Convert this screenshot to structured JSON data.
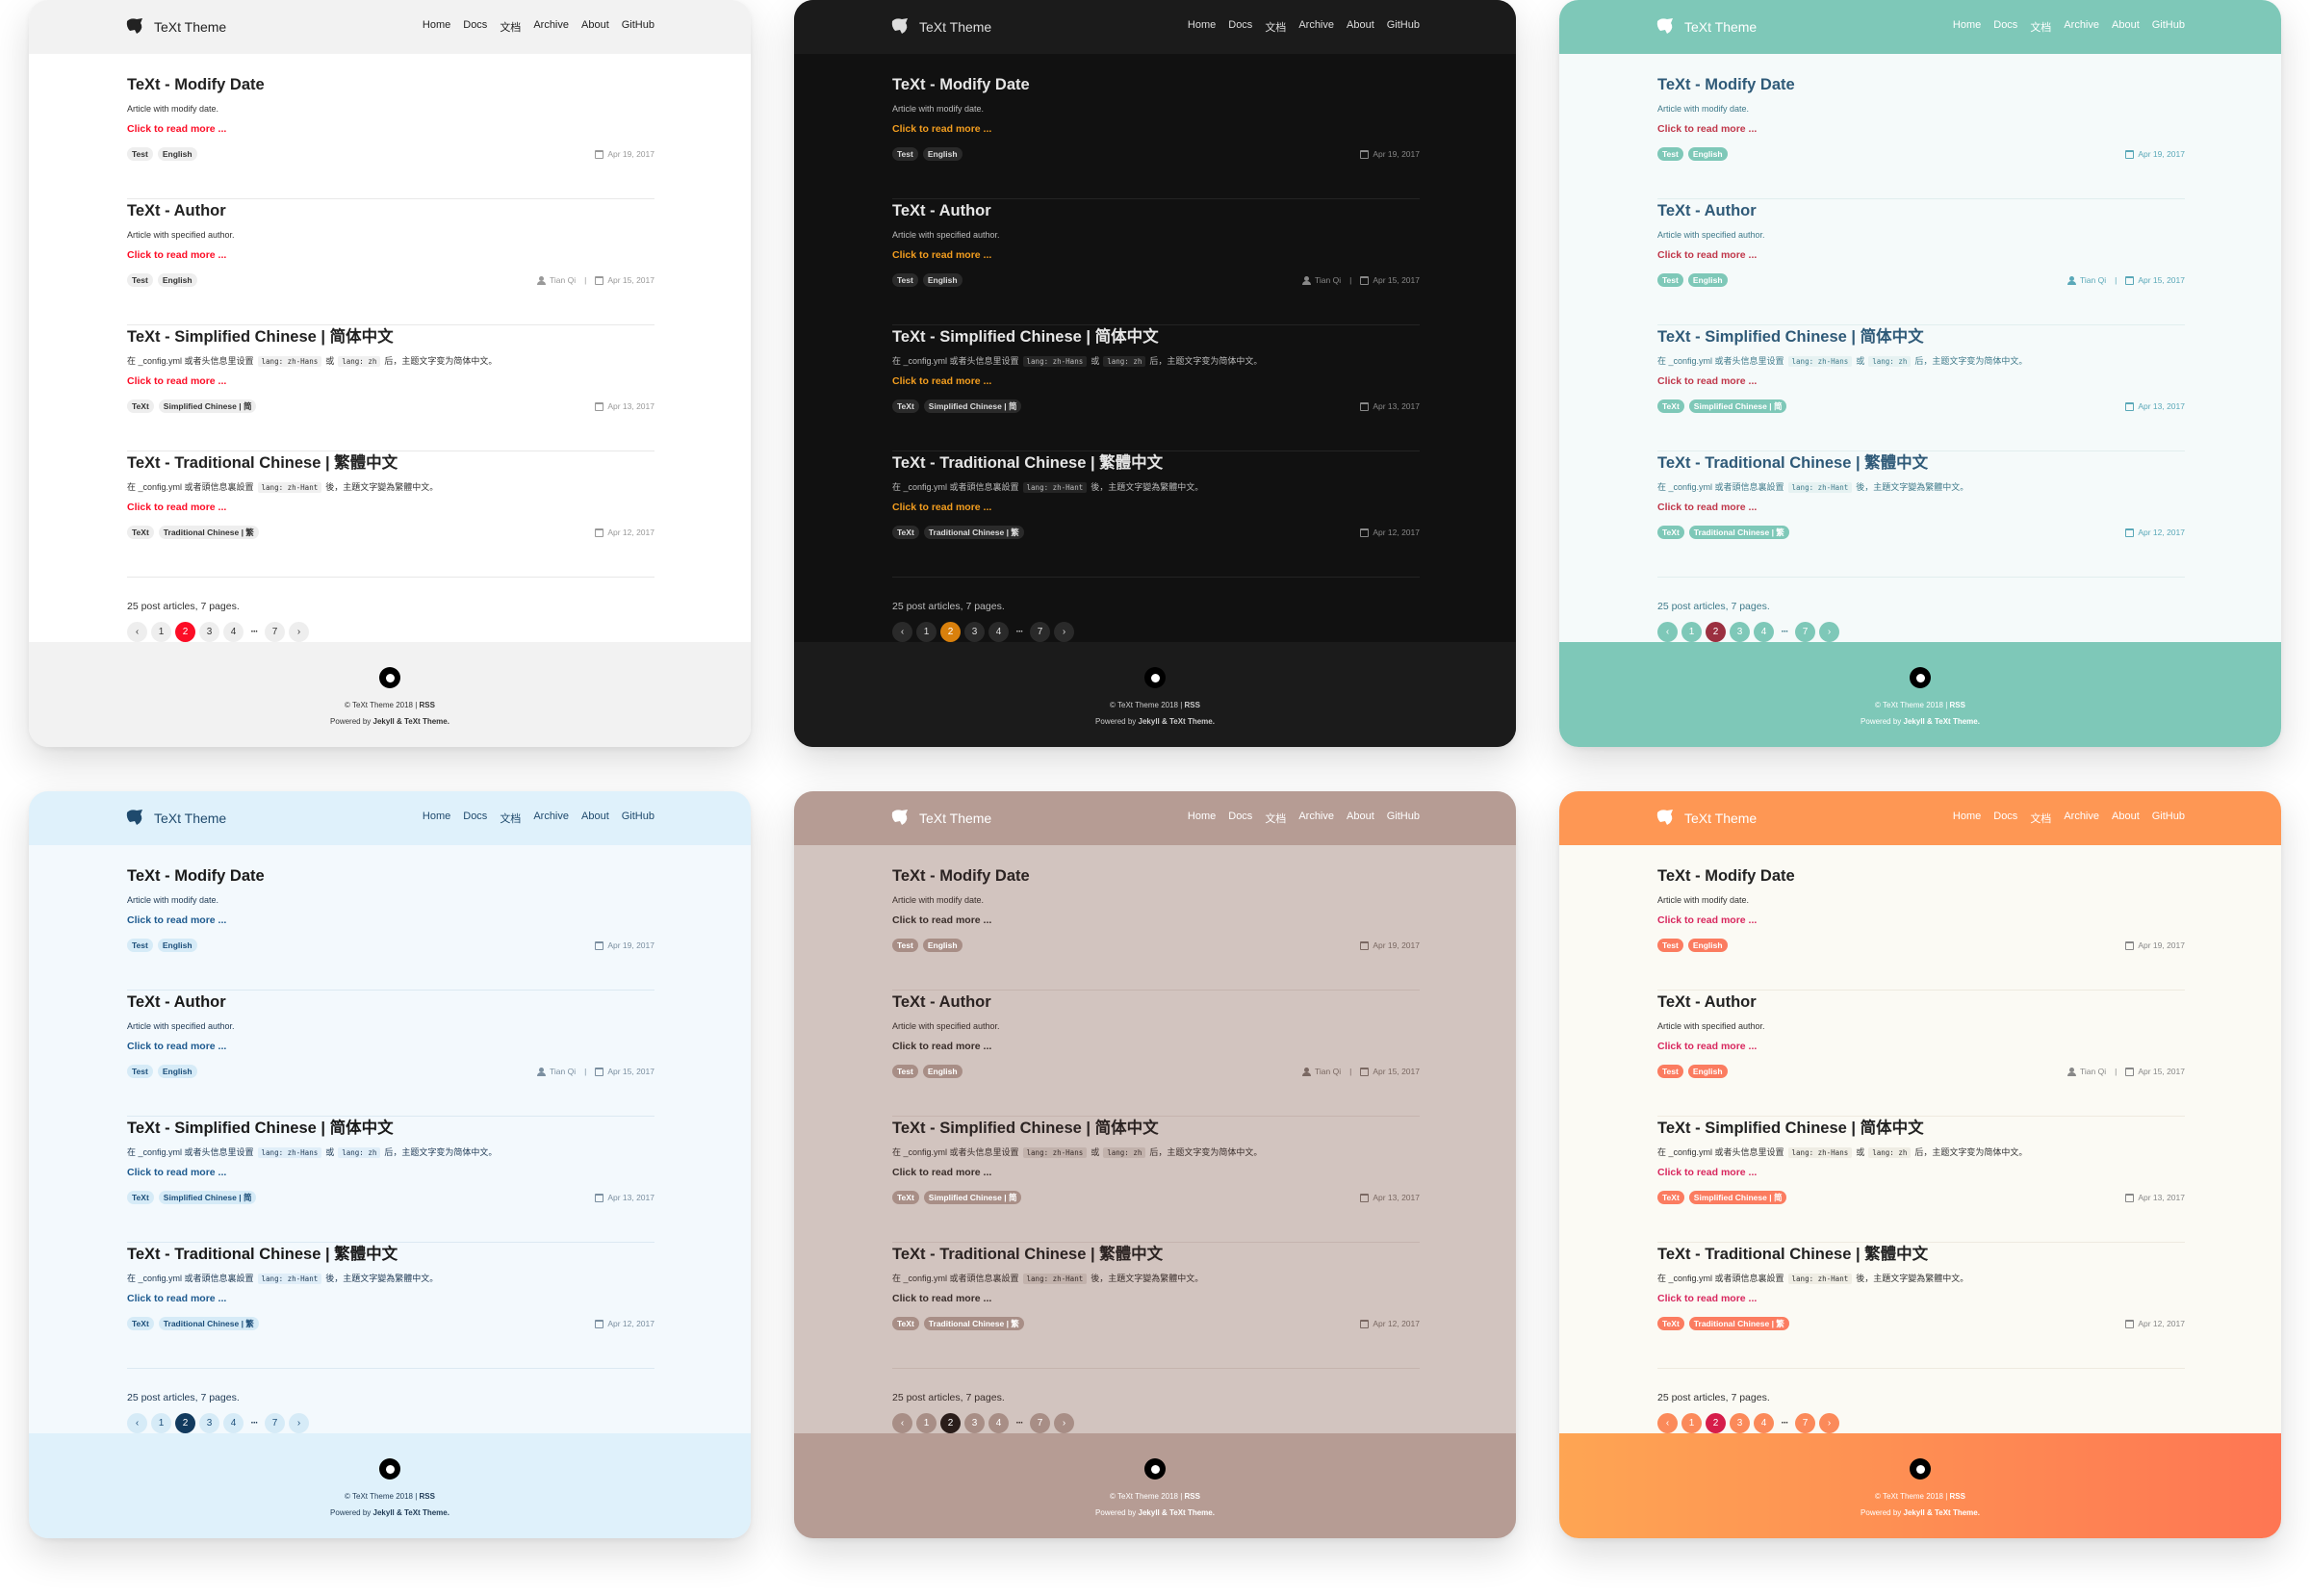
{
  "site": {
    "brand": "TeXt Theme",
    "nav": [
      "Home",
      "Docs",
      "文档",
      "Archive",
      "About",
      "GitHub"
    ],
    "read_more": "Click to read more ...",
    "summary": "25 post articles, 7 pages.",
    "pager": [
      "‹",
      "1",
      "2",
      "3",
      "4",
      "···",
      "7",
      "›"
    ],
    "footer_copy": "© TeXt Theme 2018 | ",
    "footer_rss": "RSS",
    "footer_powered_prefix": "Powered by ",
    "footer_powered_strong": "Jekyll & TeXt Theme.",
    "articles": [
      {
        "title": "TeXt - Modify Date",
        "excerpt_before": "Article with modify date.",
        "code1": "",
        "mid": "",
        "code2": "",
        "after": "",
        "tags": [
          "Test",
          "English"
        ],
        "author": "",
        "date": "Apr 19, 2017"
      },
      {
        "title": "TeXt - Author",
        "excerpt_before": "Article with specified author.",
        "code1": "",
        "mid": "",
        "code2": "",
        "after": "",
        "tags": [
          "Test",
          "English"
        ],
        "author": "Tian Qi",
        "date": "Apr 15, 2017"
      },
      {
        "title": "TeXt - Simplified Chinese | 简体中文",
        "excerpt_before": "在 _config.yml 或者头信息里设置",
        "code1": "lang: zh-Hans",
        "mid": "或",
        "code2": "lang: zh",
        "after": "后，主题文字变为简体中文。",
        "tags": [
          "TeXt",
          "Simplified Chinese | 简"
        ],
        "author": "",
        "date": "Apr 13, 2017"
      },
      {
        "title": "TeXt - Traditional Chinese | 繁體中文",
        "excerpt_before": "在 _config.yml 或者頭信息裏設置",
        "code1": "lang: zh-Hant",
        "mid": "",
        "code2": "",
        "after": "後，主題文字變為繁體中文。",
        "tags": [
          "TeXt",
          "Traditional Chinese | 繁"
        ],
        "author": "",
        "date": "Apr 12, 2017"
      }
    ]
  },
  "skins": [
    {
      "name": "default",
      "header_bg": "#f2f2f2",
      "header_text": "#222222",
      "main_bg": "#ffffff",
      "title": "#222222",
      "text": "#333333",
      "more": "#fc0d26",
      "tag_bg": "#eeeeee",
      "tag_text": "#333333",
      "meta": "#999999",
      "divider": "#e8e8e8",
      "code_bg": "#f0f0f0",
      "pg_bg": "#eeeeee",
      "pg_text": "#333333",
      "pg_active_bg": "#fc0d26",
      "pg_active_text": "#ffffff",
      "footer_bg": "#f2f2f2",
      "footer_text": "#333333"
    },
    {
      "name": "dark",
      "header_bg": "#1b1b1b",
      "header_text": "#dddddd",
      "main_bg": "#111111",
      "title": "#e6e6e6",
      "text": "#bbbbbb",
      "more": "#f29d1f",
      "tag_bg": "#2a2a2a",
      "tag_text": "#dddddd",
      "meta": "#888888",
      "divider": "#242424",
      "code_bg": "#252525",
      "pg_bg": "#2a2a2a",
      "pg_text": "#dddddd",
      "pg_active_bg": "#d9800c",
      "pg_active_text": "#ffffff",
      "footer_bg": "#1b1b1b",
      "footer_text": "#cccccc"
    },
    {
      "name": "forest",
      "header_bg": "#7ec8b8",
      "header_text": "#ffffff",
      "main_bg": "#f5fafa",
      "title": "#2f5a78",
      "text": "#3f7a8a",
      "more": "#c0374a",
      "tag_bg": "#7ec8b8",
      "tag_text": "#ffffff",
      "meta": "#5aa8b8",
      "divider": "#e1eeee",
      "code_bg": "#e6f2f2",
      "pg_bg": "#7ec8b8",
      "pg_text": "#ffffff",
      "pg_active_bg": "#9b3040",
      "pg_active_text": "#ffffff",
      "footer_bg": "#7ec8b8",
      "footer_text": "#ffffff"
    },
    {
      "name": "ocean",
      "header_bg": "#dff1fb",
      "header_text": "#1f4a6d",
      "main_bg": "#f3f9fd",
      "title": "#1a1a1a",
      "text": "#1f3a55",
      "more": "#1d5a8f",
      "tag_bg": "#d6ebf7",
      "tag_text": "#1d4f7a",
      "meta": "#7b8fa0",
      "divider": "#dce9f2",
      "code_bg": "#e0eef8",
      "pg_bg": "#d6ebf7",
      "pg_text": "#1d4f7a",
      "pg_active_bg": "#123a5e",
      "pg_active_text": "#ffffff",
      "footer_bg": "#dff1fb",
      "footer_text": "#1f3a55"
    },
    {
      "name": "chocolate",
      "header_bg": "#b69c94",
      "header_text": "#ffffff",
      "main_bg": "#d2c4bf",
      "title": "#2b2322",
      "text": "#3a2e2b",
      "more": "#3a2e2b",
      "tag_bg": "#a88e86",
      "tag_text": "#ffffff",
      "meta": "#7a6862",
      "divider": "#c5b4ae",
      "code_bg": "#c2b2ac",
      "pg_bg": "#a88e86",
      "pg_text": "#ffffff",
      "pg_active_bg": "#2a1d1a",
      "pg_active_text": "#ffffff",
      "footer_bg": "#b69c94",
      "footer_text": "#ffffff"
    },
    {
      "name": "orange",
      "header_bg": "#fe9754",
      "header_text": "#ffffff",
      "main_bg": "#fbfaf4",
      "title": "#222222",
      "text": "#333333",
      "more": "#d8275e",
      "tag_bg": "#fb7c60",
      "tag_text": "#ffffff",
      "meta": "#888888",
      "divider": "#eeeae0",
      "code_bg": "#efede4",
      "pg_bg": "#fb8a5a",
      "pg_text": "#ffffff",
      "pg_active_bg": "#d61d4a",
      "pg_active_text": "#ffffff",
      "footer_bg": "#fe9b54",
      "footer_text": "#ffffff"
    }
  ]
}
